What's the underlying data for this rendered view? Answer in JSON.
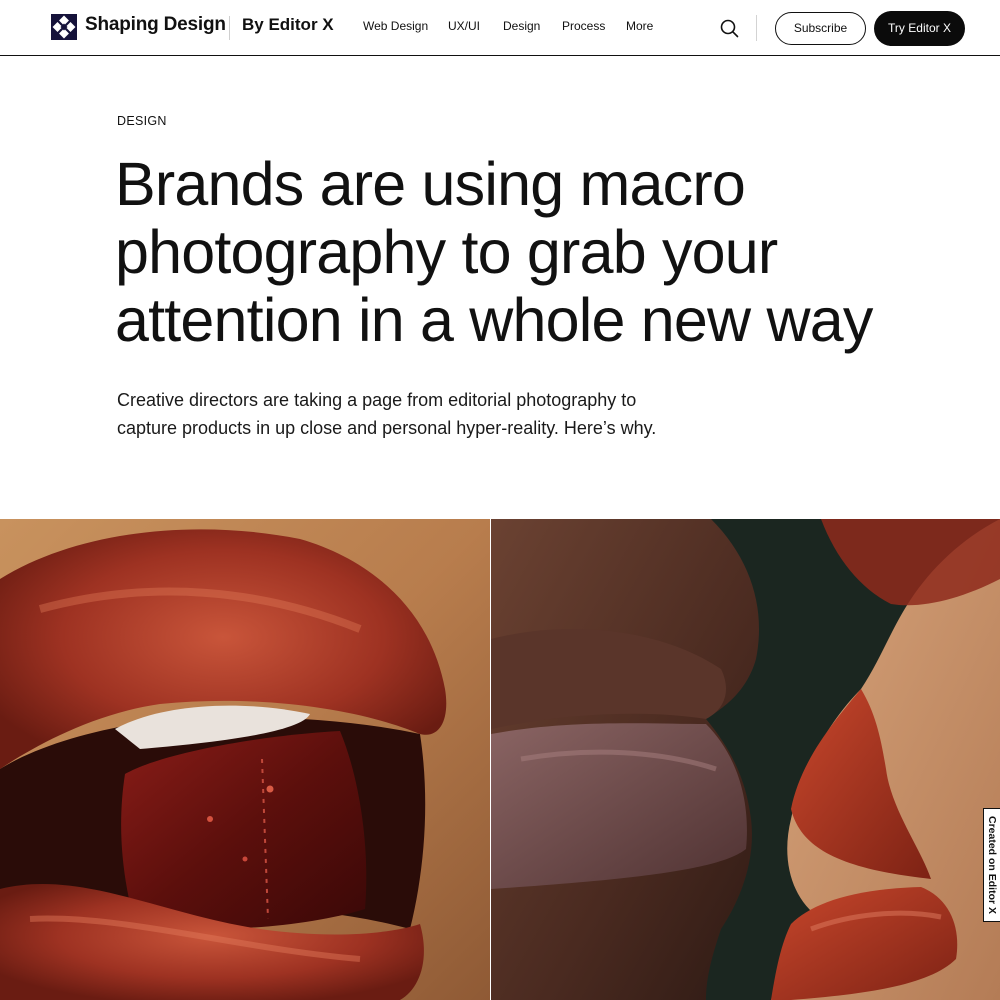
{
  "header": {
    "brand_name": "Shaping Design",
    "brand_by": "By Editor X",
    "logo_icon": "diamond-grid-logo-icon",
    "nav": [
      {
        "label": "Web Design"
      },
      {
        "label": "UX/UI"
      },
      {
        "label": "Design"
      },
      {
        "label": "Process"
      },
      {
        "label": "More"
      }
    ],
    "search_icon": "search-icon",
    "subscribe_label": "Subscribe",
    "try_label": "Try Editor X"
  },
  "article": {
    "category": "DESIGN",
    "headline": "Brands are using macro photography to grab your attention in a whole new way",
    "dek": "Creative directors are taking a page from editorial photography to capture products in up close and personal hyper-reality. Here’s why."
  },
  "images": {
    "left": "macro photo of red lips biting a translucent red cube",
    "right": "macro photo of two faces about to kiss, lips in close-up"
  },
  "badge": {
    "label": "Created on Editor X"
  },
  "colors": {
    "logo_bg": "#15123a",
    "primary_button": "#0b0b0b",
    "text": "#111111",
    "background": "#ffffff"
  }
}
